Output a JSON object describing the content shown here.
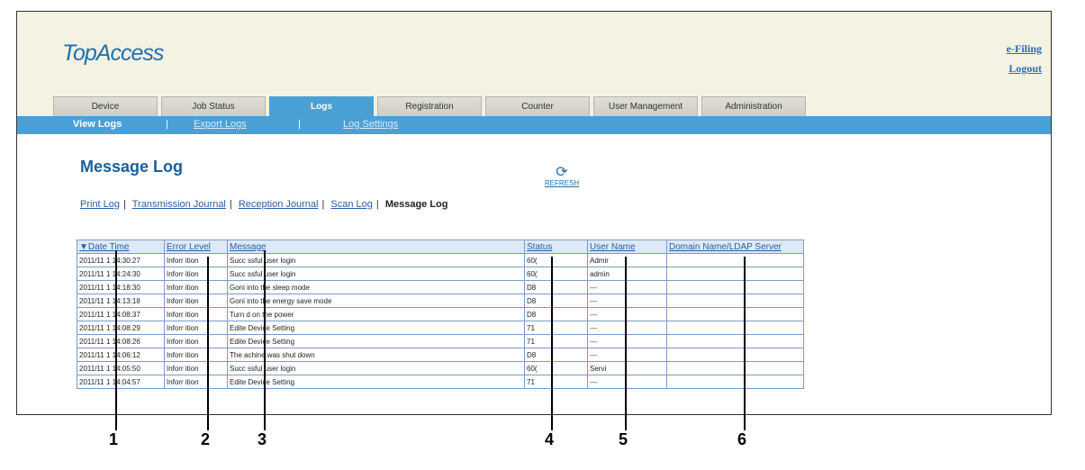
{
  "app": {
    "logo": "TopAccess"
  },
  "top_links": [
    "e-Filing",
    "Logout"
  ],
  "tabs": [
    {
      "label": "Device"
    },
    {
      "label": "Job Status"
    },
    {
      "label": "Logs"
    },
    {
      "label": "Registration"
    },
    {
      "label": "Counter"
    },
    {
      "label": "User Management"
    },
    {
      "label": "Administration"
    }
  ],
  "subnav": {
    "view_logs": "View Logs",
    "export_logs": "Export Logs",
    "log_settings": "Log Settings",
    "sep": "|"
  },
  "page_title": "Message Log",
  "refresh_label": "REFRESH",
  "log_links": [
    "Print Log",
    "Transmission Journal",
    "Reception Journal",
    "Scan Log"
  ],
  "log_current": "Message Log",
  "table": {
    "sort_arrow": "▼",
    "headers": [
      "Date Time",
      "Error Level",
      "Message",
      "Status",
      "User Name",
      "Domain Name/LDAP Server"
    ],
    "rows": [
      [
        "2011/11 1 14:30:27",
        "Inforr ition",
        "Succ ssful user login",
        "60(",
        "Admir",
        ""
      ],
      [
        "2011/11 1 14:24:30",
        "Inforr ition",
        "Succ ssful user login",
        "60(",
        "admin",
        ""
      ],
      [
        "2011/11 1 14:18:30",
        "Inforr ition",
        "Goni into the sleep mode",
        "D8",
        "---",
        ""
      ],
      [
        "2011/11 1 14:13:18",
        "Inforr ition",
        "Goni into the energy save mode",
        "D8",
        "---",
        ""
      ],
      [
        "2011/11 1 14:08:37",
        "Inforr ition",
        "Turn d on the power",
        "D8",
        "---",
        ""
      ],
      [
        "2011/11 1 14:08:29",
        "Inforr ition",
        "Edite Device Setting",
        "71",
        "---",
        ""
      ],
      [
        "2011/11 1 14:08:26",
        "Inforr ition",
        "Edite Device Setting",
        "71",
        "---",
        ""
      ],
      [
        "2011/11 1 14:06:12",
        "Inforr ition",
        "The achine was shut down",
        "D8",
        "---",
        ""
      ],
      [
        "2011/11 1 14:05:50",
        "Inforr ition",
        "Succ ssful user login",
        "60(",
        "Servi",
        ""
      ],
      [
        "2011/11 1 14:04:57",
        "Inforr ition",
        "Edite Device Setting",
        "71",
        "---",
        ""
      ]
    ]
  },
  "callouts": [
    "1",
    "2",
    "3",
    "4",
    "5",
    "6"
  ]
}
